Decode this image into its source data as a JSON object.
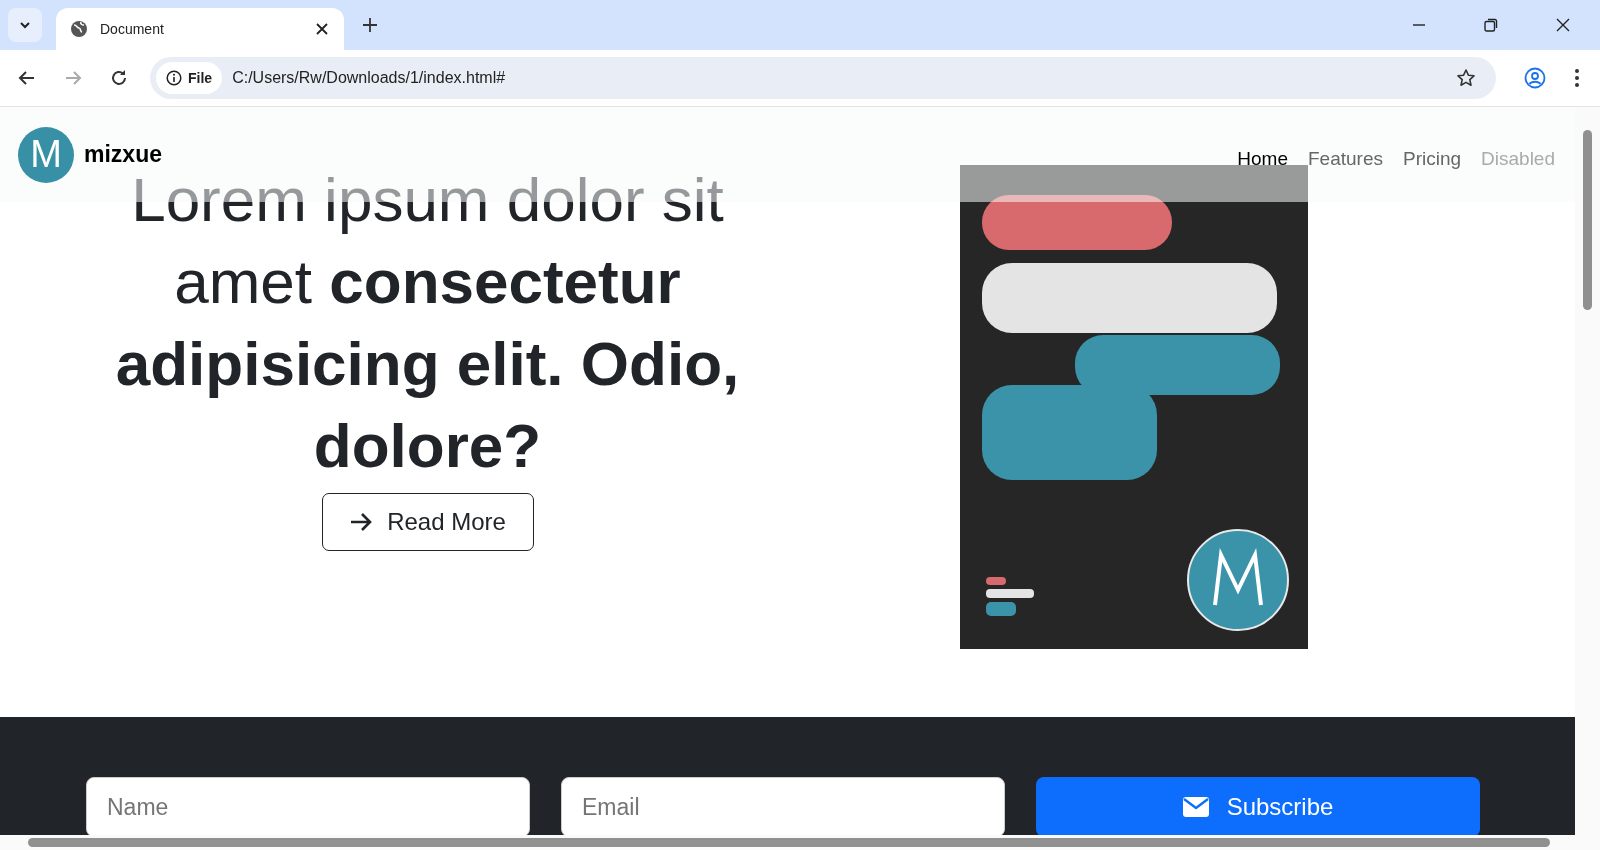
{
  "browser": {
    "tab_title": "Document",
    "url_chip": "File",
    "url": "C:/Users/Rw/Downloads/1/index.html#"
  },
  "navbar": {
    "logo_letter": "M",
    "brand": "mizxue",
    "links": [
      {
        "label": "Home",
        "selected": true,
        "disabled": false
      },
      {
        "label": "Features",
        "selected": false,
        "disabled": false
      },
      {
        "label": "Pricing",
        "selected": false,
        "disabled": false
      },
      {
        "label": "Disabled",
        "selected": false,
        "disabled": true
      }
    ]
  },
  "hero": {
    "headline": "Lorem ipsum dolor sit amet **consectetur adipisicing elit. Odio, dolore?**",
    "button": "Read More"
  },
  "subscribe": {
    "name_placeholder": "Name",
    "email_placeholder": "Email",
    "button": "Subscribe"
  }
}
